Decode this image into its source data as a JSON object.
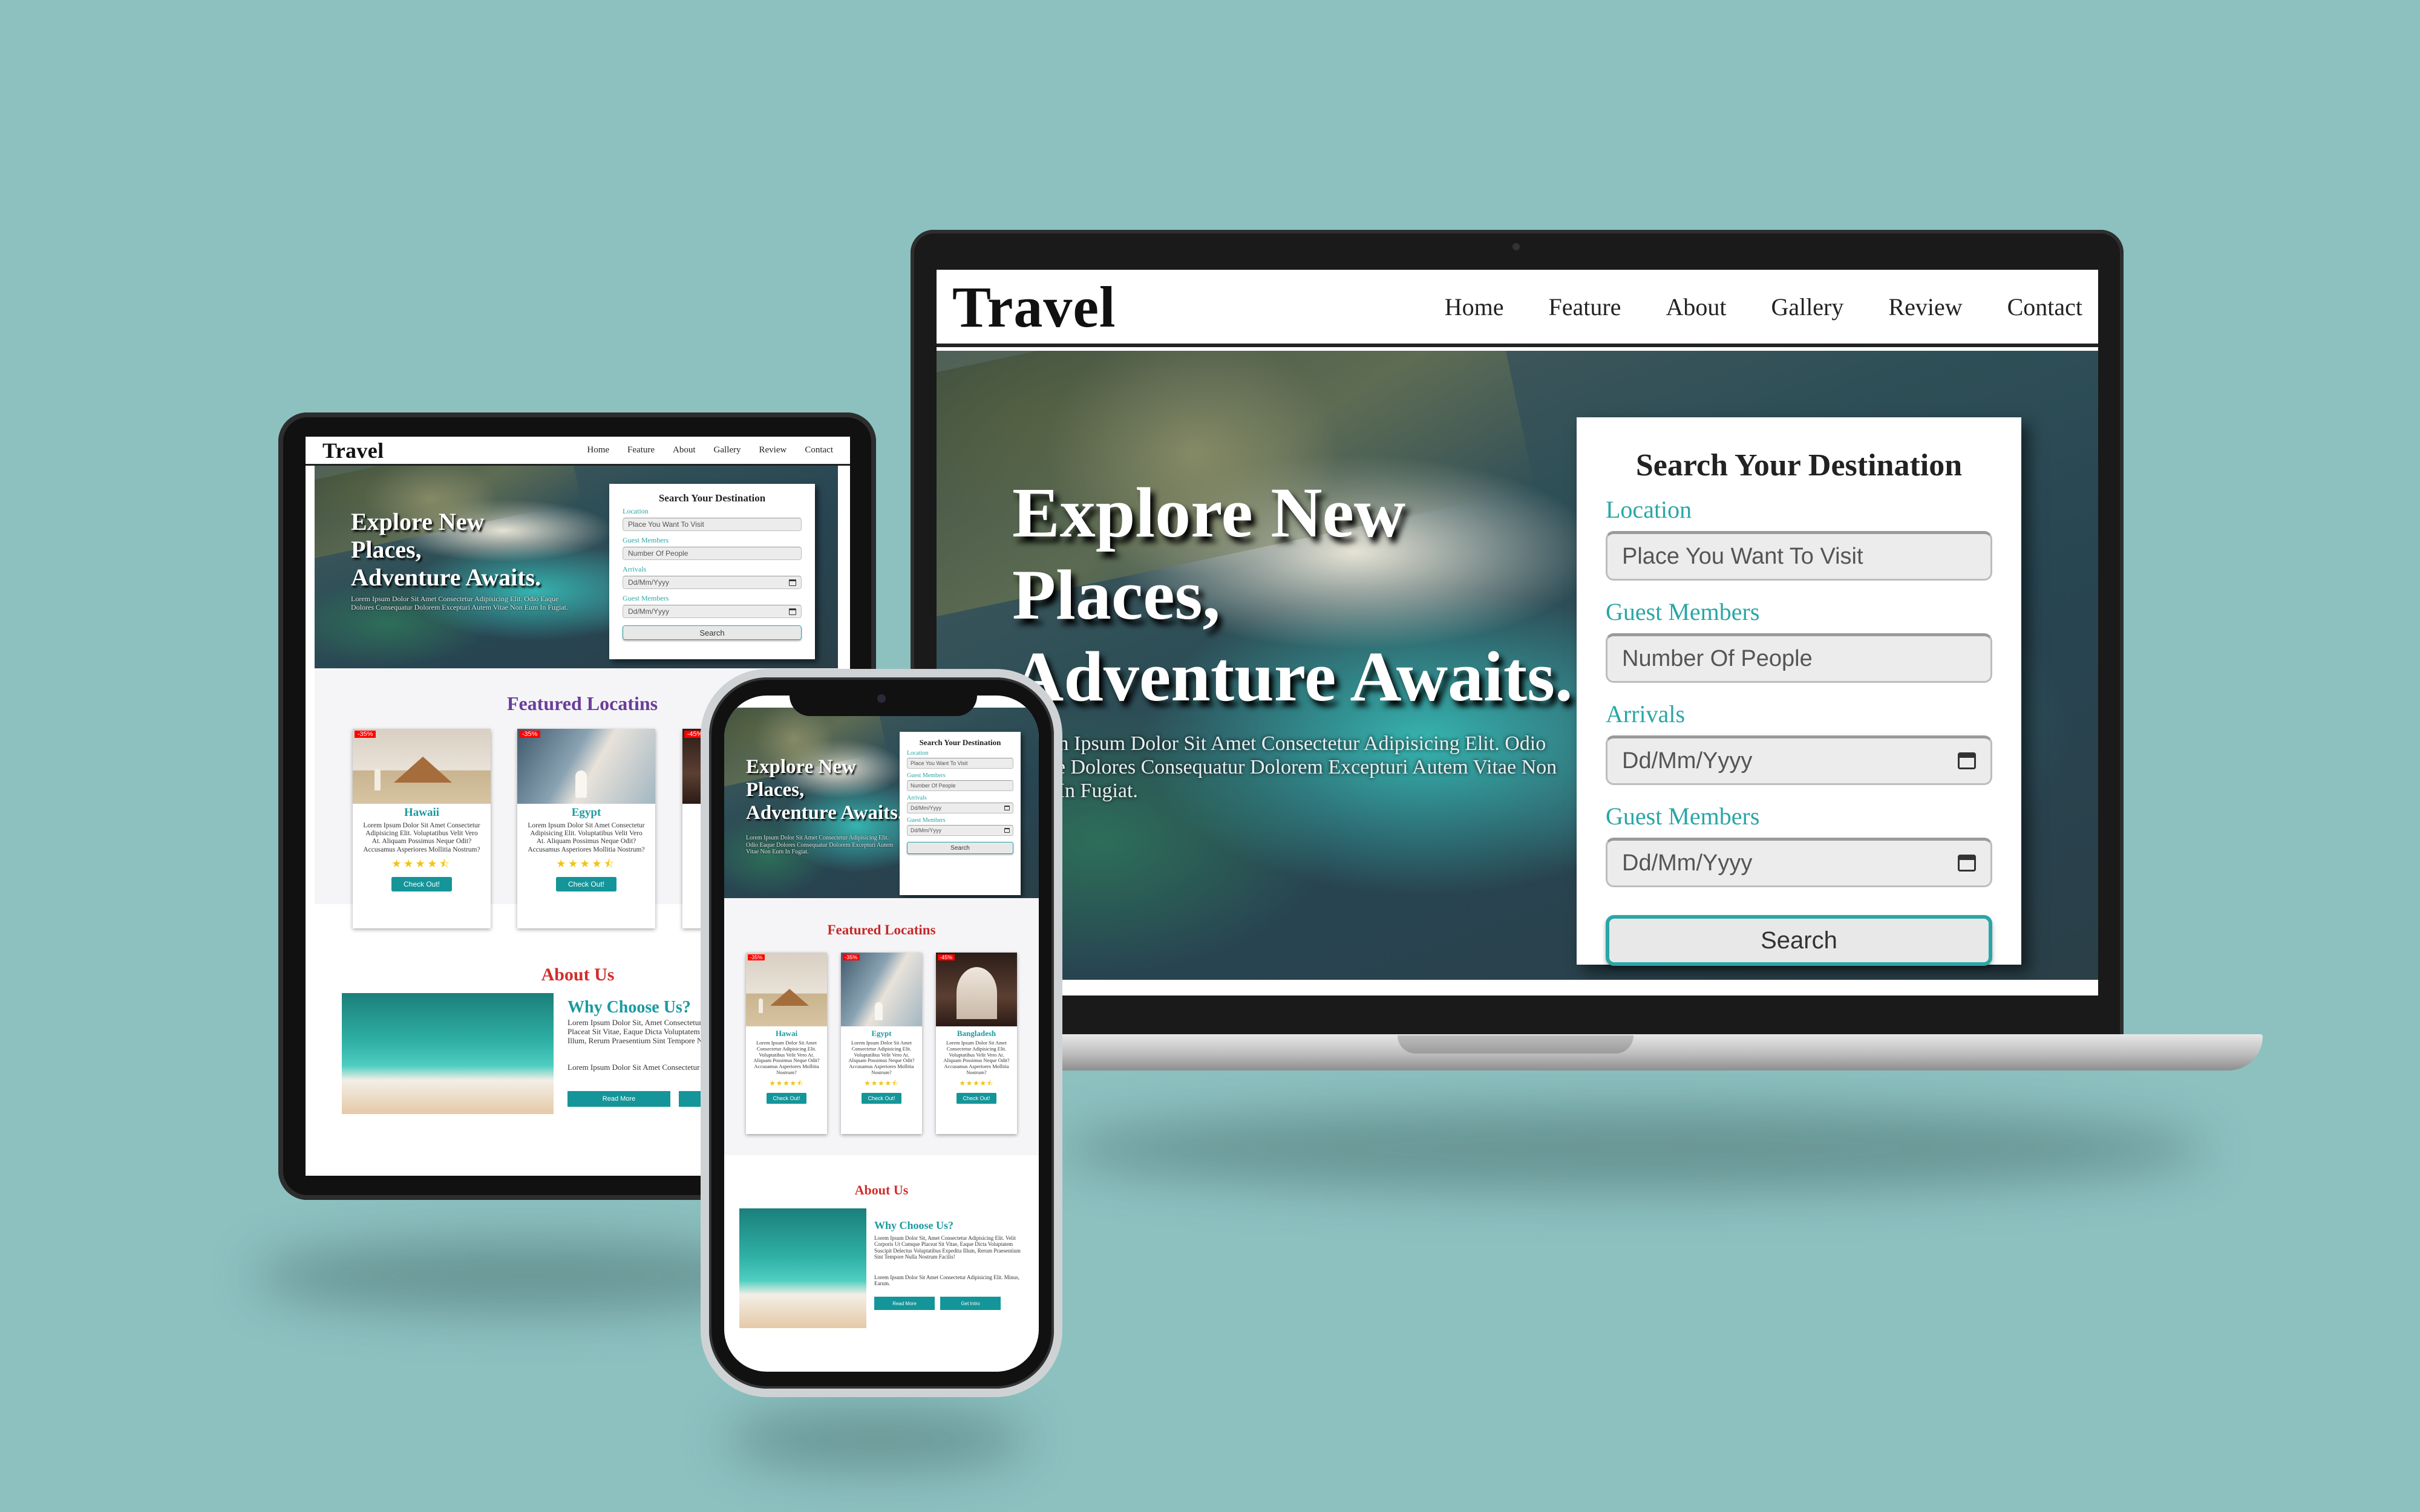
{
  "site": {
    "logo": "Travel",
    "nav": [
      "Home",
      "Feature",
      "About",
      "Gallery",
      "Review",
      "Contact"
    ],
    "hero": {
      "line1": "Explore New",
      "line2": "Places,",
      "line3": "Adventure Awaits.",
      "subtitle": "Lorem Ipsum Dolor Sit Amet Consectetur Adipisicing Elit. Odio Eaque Dolores Consequatur Dolorem Excepturi Autem Vitae Non Eum In Fugiat."
    },
    "search": {
      "title": "Search Your Destination",
      "location_label": "Location",
      "location_placeholder": "Place You Want To Visit",
      "guests_label": "Guest Members",
      "guests_placeholder": "Number Of People",
      "arrivals_label": "Arrivals",
      "arrivals_placeholder": "Dd/Mm/Yyyy",
      "guests2_label": "Guest Members",
      "guests2_placeholder": "Dd/Mm/Yyyy",
      "button": "Search"
    },
    "featured_title": "Featured Locatins",
    "featured_title_color": "#6a3d9a",
    "featured_title_color_phone": "#c62828",
    "tablet_cards": [
      {
        "badge": "-35%",
        "name": "Hawaii",
        "desc": "Lorem Ipsum Dolor Sit Amet Consectetur Adipisicing Elit. Voluptatibus Velit Vero At. Aliquam Possimus Neque Odit? Accusamus Asperiores Mollitia Nostrum?",
        "stars": "★★★★⯪",
        "button": "Check Out!"
      },
      {
        "badge": "-35%",
        "name": "Egypt",
        "desc": "Lorem Ipsum Dolor Sit Amet Consectetur Adipisicing Elit. Voluptatibus Velit Vero At. Aliquam Possimus Neque Odit? Accusamus Asperiores Mollitia Nostrum?",
        "stars": "★★★★⯪",
        "button": "Check Out!"
      },
      {
        "badge": "-45%"
      }
    ],
    "phone_cards": [
      {
        "badge": "-35%",
        "name": "Hawai",
        "desc": "Lorem Ipsum Dolor Sit Amet Consectetur Adipisicing Elit. Voluptatibus Velit Vero At. Aliquam Possimus Neque Odit? Accusamus Asperiores Mollitia Nostrum?",
        "stars": "★★★★⯪",
        "button": "Check Out!"
      },
      {
        "badge": "-35%",
        "name": "Egypt",
        "desc": "Lorem Ipsum Dolor Sit Amet Consectetur Adipisicing Elit. Voluptatibus Velit Vero At. Aliquam Possimus Neque Odit? Accusamus Asperiores Mollitia Nostrum?",
        "stars": "★★★★⯪",
        "button": "Check Out!"
      },
      {
        "badge": "-45%",
        "name": "Bangladesh",
        "desc": "Lorem Ipsum Dolor Sit Amet Consectetur Adipisicing Elit. Voluptatibus Velit Vero At. Aliquam Possimus Neque Odit? Accusamus Asperiores Mollitia Nostrum?",
        "stars": "★★★★⯪",
        "button": "Check Out!"
      }
    ],
    "about": {
      "title": "About Us",
      "why": "Why Choose Us?",
      "p1": "Lorem Ipsum Dolor Sit, Amet Consectetur Adipisicing Elit. Velit Corporis Ut Cumque Placeat Sit Vitae, Eaque Dicta Voluptatem Suscipit Delectus Voluptatibus Expedita Illum, Rerum Praesentium Sint Tempore Nulla Nostrum Facilis!",
      "p2": "Lorem Ipsum Dolor Sit Amet Consectetur Adipisicing Elit. Minus, Earum.",
      "read_more": "Read More",
      "get_intro": "Get Intro"
    }
  },
  "colors": {
    "background": "#8cc1c0",
    "accent": "#14959a",
    "label": "#2aa6a6",
    "badge": "#ff0000",
    "about_title": "#d12d2d"
  }
}
